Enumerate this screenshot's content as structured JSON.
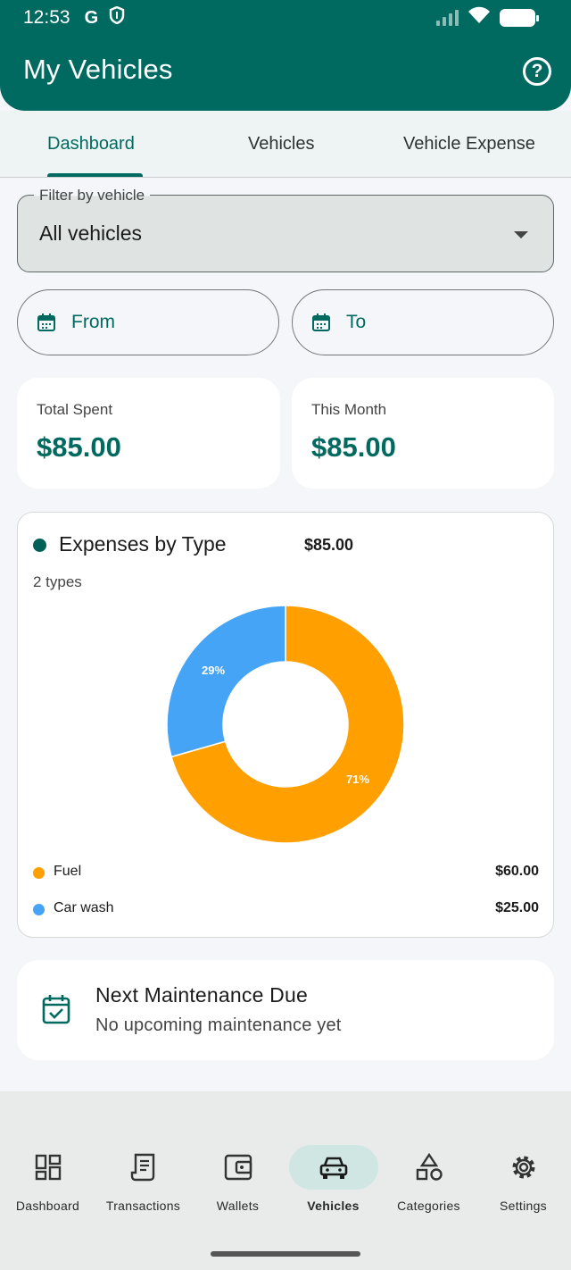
{
  "status_bar": {
    "time": "12:53",
    "icon_g": "G"
  },
  "app_bar": {
    "title": "My Vehicles",
    "help_symbol": "?"
  },
  "tabs": [
    {
      "label": "Dashboard",
      "active": true
    },
    {
      "label": "Vehicles",
      "active": false
    },
    {
      "label": "Vehicle Expense",
      "active": false
    }
  ],
  "filter": {
    "label": "Filter by vehicle",
    "value": "All vehicles"
  },
  "date_range": {
    "from_label": "From",
    "to_label": "To"
  },
  "stats": [
    {
      "label": "Total Spent",
      "value": "$85.00"
    },
    {
      "label": "This Month",
      "value": "$85.00"
    }
  ],
  "expenses_card": {
    "title": "Expenses by Type",
    "total": "$85.00",
    "subtitle": "2 types"
  },
  "chart_data": {
    "type": "pie",
    "title": "Expenses by Type",
    "categories": [
      "Fuel",
      "Car wash"
    ],
    "values": [
      60,
      25
    ],
    "amount_labels": [
      "$60.00",
      "$25.00"
    ],
    "percent_labels": [
      "71%",
      "29%"
    ],
    "colors": [
      "#ff9f00",
      "#45a4f5"
    ],
    "style": "donut",
    "legend": "bottom"
  },
  "maintenance": {
    "title": "Next Maintenance Due",
    "subtitle": "No upcoming maintenance yet"
  },
  "bottom_nav": [
    {
      "label": "Dashboard",
      "icon": "dashboard-icon",
      "active": false
    },
    {
      "label": "Transactions",
      "icon": "receipt-icon",
      "active": false
    },
    {
      "label": "Wallets",
      "icon": "wallet-icon",
      "active": false
    },
    {
      "label": "Vehicles",
      "icon": "car-icon",
      "active": true
    },
    {
      "label": "Categories",
      "icon": "shapes-icon",
      "active": false
    },
    {
      "label": "Settings",
      "icon": "gear-icon",
      "active": false
    }
  ],
  "colors": {
    "primary": "#006a60",
    "background": "#f4f6f9",
    "card": "#ffffff",
    "nav_background": "#e8ebea",
    "nav_active_pill": "#cfe6e2"
  }
}
